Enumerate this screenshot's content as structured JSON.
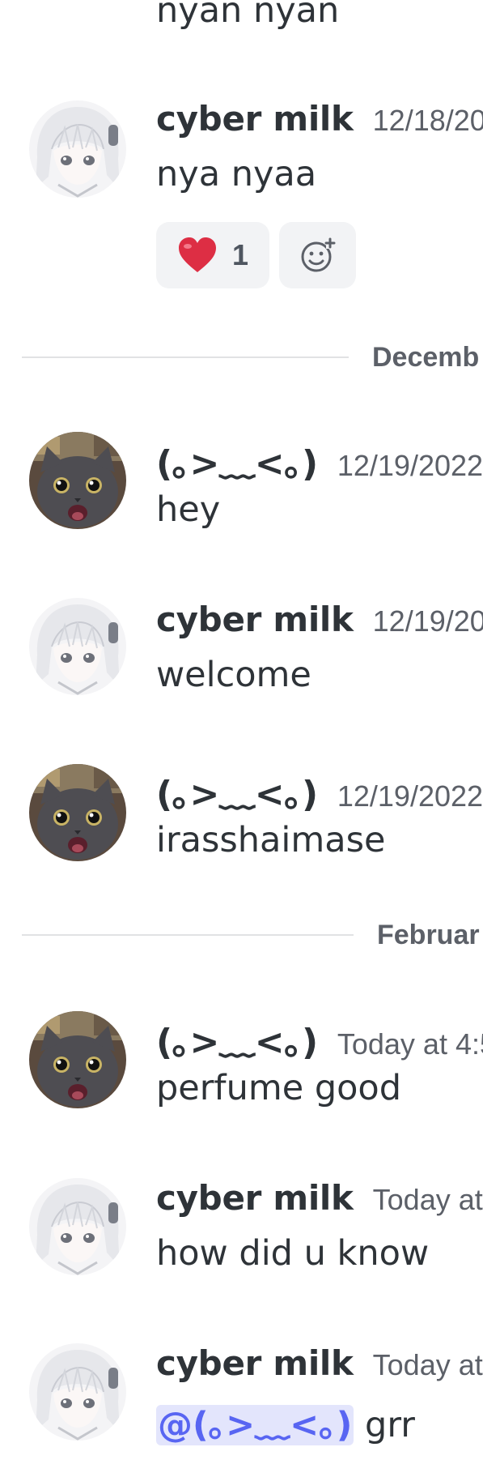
{
  "previous_message": {
    "content": "nyan nyan"
  },
  "messages": [
    {
      "author": "cyber milk",
      "avatar": "anime-girl-avatar",
      "timestamp": "12/18/20",
      "content": "nya nyaa",
      "reactions": [
        {
          "emoji": "❤️",
          "count": "1"
        },
        {
          "icon": "add-reaction-icon"
        }
      ]
    },
    {
      "author": "(｡>﹏<｡)",
      "avatar": "cat-avatar",
      "timestamp": "12/19/2022",
      "content": "hey"
    },
    {
      "author": "cyber milk",
      "avatar": "anime-girl-avatar",
      "timestamp": "12/19/202",
      "content": "welcome"
    },
    {
      "author": "(｡>﹏<｡)",
      "avatar": "cat-avatar",
      "timestamp": "12/19/2022",
      "content": "irasshaimase"
    },
    {
      "author": "(｡>﹏<｡)",
      "avatar": "cat-avatar",
      "timestamp": "Today at 4:5",
      "content": "perfume good"
    },
    {
      "author": "cyber milk",
      "avatar": "anime-girl-avatar",
      "timestamp": "Today at",
      "content": "how did u know"
    },
    {
      "author": "cyber milk",
      "avatar": "anime-girl-avatar",
      "timestamp": "Today at",
      "mention": "@(｡>﹏<｡)",
      "content": "grr"
    }
  ],
  "dividers": [
    {
      "label": "Decemb"
    },
    {
      "label": "Februar"
    }
  ],
  "colors": {
    "background": "#ffffff",
    "text": "#2e3338",
    "muted": "#5c6068",
    "mention_bg": "#e3e5fc",
    "mention_text": "#5865f2",
    "reaction_bg": "#f2f3f5",
    "heart": "#dd2e44"
  }
}
